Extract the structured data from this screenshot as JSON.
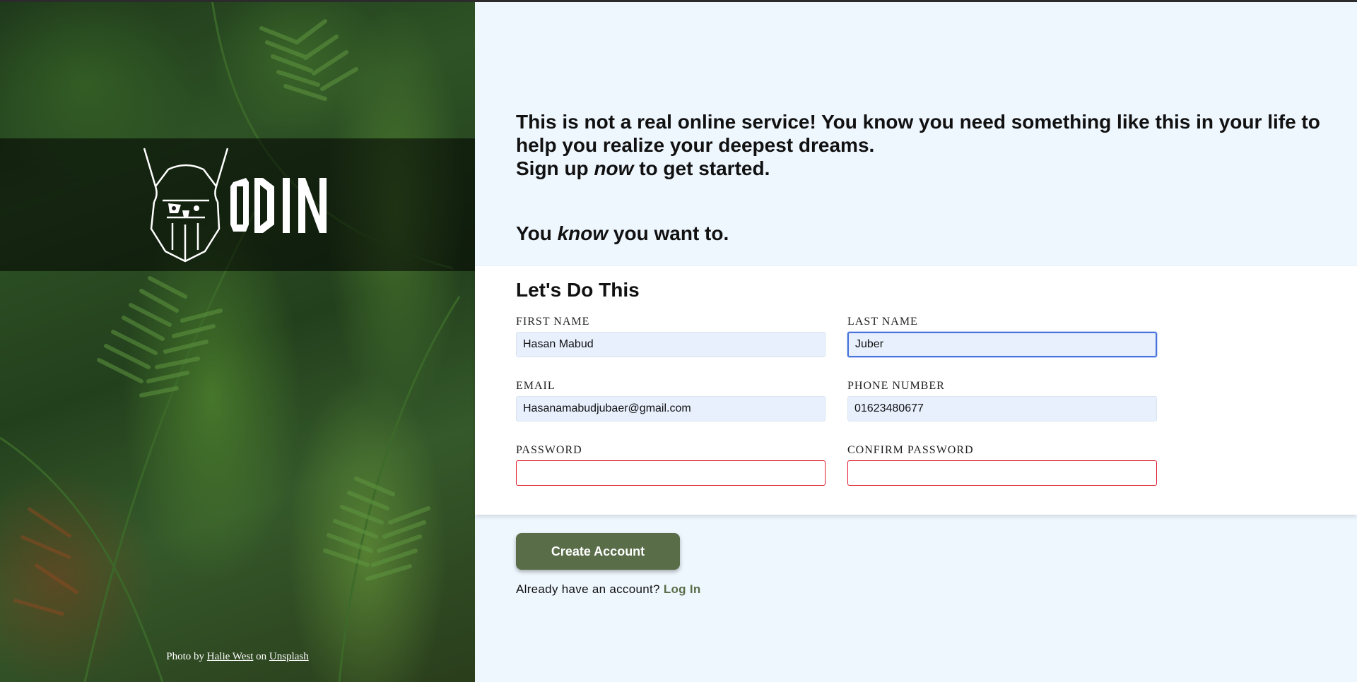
{
  "intro": {
    "line1": "This is not a real online service! You know you need something like this in your life to help you realize your deepest dreams.",
    "line2_before": "Sign up ",
    "line2_em": "now",
    "line2_after": " to get started.",
    "line3_before": "You ",
    "line3_em": "know",
    "line3_after": " you want to."
  },
  "logo": {
    "text": "ODIN",
    "icon": "viking-head-icon"
  },
  "credit": {
    "prefix": "Photo by ",
    "author": "Halie West",
    "middle": " on ",
    "site": "Unsplash"
  },
  "form": {
    "title": "Let's Do This",
    "first_name": {
      "label": "FIRST NAME",
      "value": "Hasan Mabud"
    },
    "last_name": {
      "label": "LAST NAME",
      "value": "Juber"
    },
    "email": {
      "label": "EMAIL",
      "value": "Hasanamabudjubaer@gmail.com"
    },
    "phone": {
      "label": "PHONE NUMBER",
      "value": "01623480677"
    },
    "password": {
      "label": "PASSWORD",
      "value": ""
    },
    "confirm_password": {
      "label": "CONFIRM PASSWORD",
      "value": ""
    }
  },
  "actions": {
    "create_account": "Create Account",
    "login_prompt": "Already have an account? ",
    "login_link": "Log In"
  },
  "colors": {
    "accent": "#596d48",
    "page_bg": "#eef6fe",
    "invalid_border": "#e0182a",
    "focus_border": "#4a74d9"
  }
}
